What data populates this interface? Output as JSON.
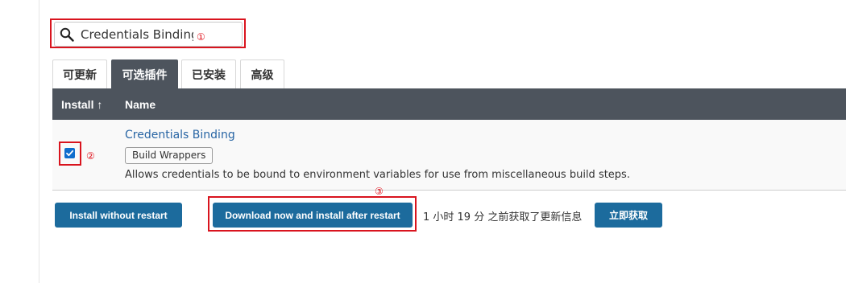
{
  "search": {
    "value": "Credentials Binding",
    "annotation": "①"
  },
  "tabs": [
    {
      "label": "可更新",
      "active": false
    },
    {
      "label": "可选插件",
      "active": true
    },
    {
      "label": "已安装",
      "active": false
    },
    {
      "label": "高级",
      "active": false
    }
  ],
  "table": {
    "headers": {
      "install": "Install ↑",
      "name": "Name"
    },
    "rows": [
      {
        "checked": true,
        "name": "Credentials Binding",
        "category": "Build Wrappers",
        "description": "Allows credentials to be bound to environment variables for use from miscellaneous build steps."
      }
    ],
    "checkbox_annotation": "②"
  },
  "actions": {
    "install_without_restart": "Install without restart",
    "download_now": "Download now and install after restart",
    "download_annotation": "③",
    "status": "1 小时 19 分 之前获取了更新信息",
    "check_now": "立即获取"
  },
  "colors": {
    "header_bg": "#4d545d",
    "button_bg": "#1c6b9d",
    "link": "#2865a4",
    "annotation_red": "#d9141e"
  }
}
